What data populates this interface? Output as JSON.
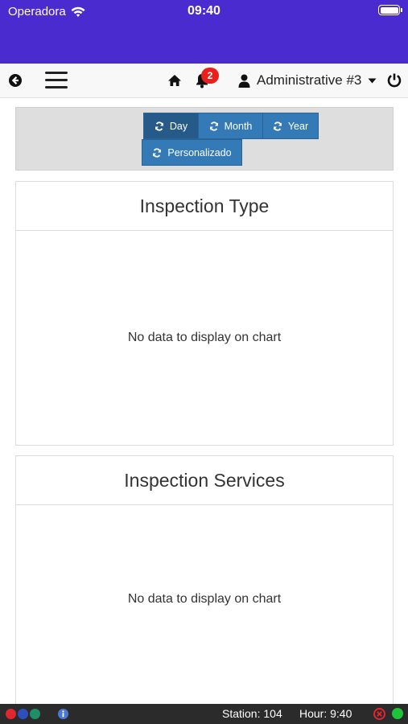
{
  "status_bar": {
    "carrier": "Operadora",
    "time": "09:40"
  },
  "navbar": {
    "notifications_count": "2",
    "user_label": "Administrative #3"
  },
  "range_buttons": [
    {
      "label": "Day",
      "active": true
    },
    {
      "label": "Month",
      "active": false
    },
    {
      "label": "Year",
      "active": false
    },
    {
      "label": "Personalizado",
      "active": false
    }
  ],
  "cards": [
    {
      "title": "Inspection Type",
      "empty_message": "No data to display on chart"
    },
    {
      "title": "Inspection Services",
      "empty_message": "No data to display on chart"
    }
  ],
  "footer": {
    "station": "Station: 104",
    "hour": "Hour: 9:40"
  },
  "colors": {
    "status_bar": "#4a2bd0",
    "button": "#337ab7",
    "button_active": "#265a88",
    "badge": "#e8211d",
    "dot_red": "#e0262e",
    "dot_blue": "#2f4fbf",
    "dot_teal": "#1f8f6a",
    "dot_green": "#1fc43b"
  },
  "icons": [
    "wifi-icon",
    "battery-icon",
    "back-arrow-icon",
    "hamburger-menu-icon",
    "home-icon",
    "bell-icon",
    "user-icon",
    "caret-down-icon",
    "power-icon",
    "refresh-icon",
    "info-icon",
    "error-icon"
  ]
}
